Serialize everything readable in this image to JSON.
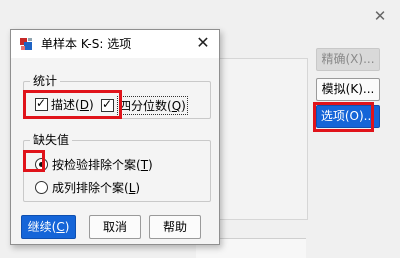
{
  "parent_dialog": {
    "close_glyph": "✕",
    "buttons": {
      "bootstrap": "精确(X)...",
      "simulate": "模拟(K)...",
      "options": "选项(O)..."
    }
  },
  "modal": {
    "title": "单样本 K-S: 选项",
    "close_glyph": "✕",
    "statistics_group": {
      "legend": "统计",
      "descriptive": {
        "text": "描述",
        "mnemonic": "D",
        "checked": true
      },
      "quartiles": {
        "text": "四分位数",
        "mnemonic": "Q",
        "checked": true
      }
    },
    "missing_group": {
      "legend": "缺失值",
      "test_by_test": {
        "text": "按检验排除个案",
        "mnemonic": "T",
        "selected": true
      },
      "listwise": {
        "text": "成列排除个案",
        "mnemonic": "L",
        "selected": false
      }
    },
    "buttons": {
      "continue": {
        "text": "继续",
        "mnemonic": "C"
      },
      "cancel": "取消",
      "help": "帮助"
    }
  },
  "colors": {
    "accent": "#1565d8",
    "highlight": "#e0131a"
  }
}
